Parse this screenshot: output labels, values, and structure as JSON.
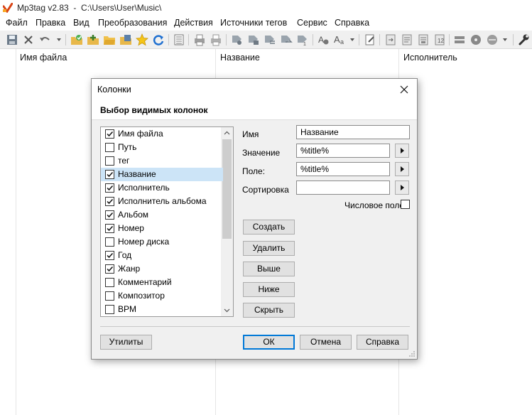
{
  "window": {
    "title": "Mp3tag v2.83  -  C:\\Users\\User\\Music\\"
  },
  "menu": [
    "Файл",
    "Правка",
    "Вид",
    "Преобразования",
    "Действия",
    "Источники тегов",
    "Сервис",
    "Справка"
  ],
  "toolbar_icons": [
    "save-icon",
    "delete-icon",
    "undo-icon",
    "undo-dropdown-icon",
    "add-directory-icon",
    "add-folder-icon",
    "open-folder-icon",
    "save-folder-icon",
    "favorite-star-icon",
    "refresh-icon",
    "list-icon",
    "print-icon",
    "print-preview-icon",
    "tag-to-filename-icon",
    "filename-to-tag-icon",
    "text-to-tag-icon",
    "tag-to-tag-icon",
    "autonumber-icon",
    "actions-icon",
    "case-conversion-icon",
    "case-dropdown-icon",
    "edit-icon",
    "export-icon",
    "import-icon",
    "playlist-icon",
    "freedb-icon",
    "web-sources-icon",
    "discogs-icon",
    "web-sources-dropdown-icon",
    "settings-wrench-icon"
  ],
  "columns": {
    "filename": "Имя файла",
    "title": "Название",
    "artist": "Исполнитель"
  },
  "dialog": {
    "title": "Колонки",
    "heading": "Выбор видимых колонок",
    "items": [
      {
        "label": "Имя файла",
        "checked": true,
        "selected": false
      },
      {
        "label": "Путь",
        "checked": false,
        "selected": false
      },
      {
        "label": "тег",
        "checked": false,
        "selected": false
      },
      {
        "label": "Название",
        "checked": true,
        "selected": true
      },
      {
        "label": "Исполнитель",
        "checked": true,
        "selected": false
      },
      {
        "label": "Исполнитель альбома",
        "checked": true,
        "selected": false
      },
      {
        "label": "Альбом",
        "checked": true,
        "selected": false
      },
      {
        "label": "Номер",
        "checked": true,
        "selected": false
      },
      {
        "label": "Номер диска",
        "checked": false,
        "selected": false
      },
      {
        "label": "Год",
        "checked": true,
        "selected": false
      },
      {
        "label": "Жанр",
        "checked": true,
        "selected": false
      },
      {
        "label": "Комментарий",
        "checked": false,
        "selected": false
      },
      {
        "label": "Композитор",
        "checked": false,
        "selected": false
      },
      {
        "label": "BPM",
        "checked": false,
        "selected": false
      }
    ],
    "fields": {
      "name_label": "Имя",
      "name_value": "Название",
      "value_label": "Значение",
      "value_value": "%title%",
      "field_label": "Поле:",
      "field_value": "%title%",
      "sort_label": "Сортировка",
      "sort_value": "",
      "numeric_label": "Числовое поле",
      "numeric_checked": false
    },
    "buttons": {
      "create": "Создать",
      "delete": "Удалить",
      "up": "Выше",
      "down": "Ниже",
      "hide": "Скрыть",
      "utilities": "Утилиты",
      "ok": "ОК",
      "cancel": "Отмена",
      "help": "Справка"
    }
  }
}
